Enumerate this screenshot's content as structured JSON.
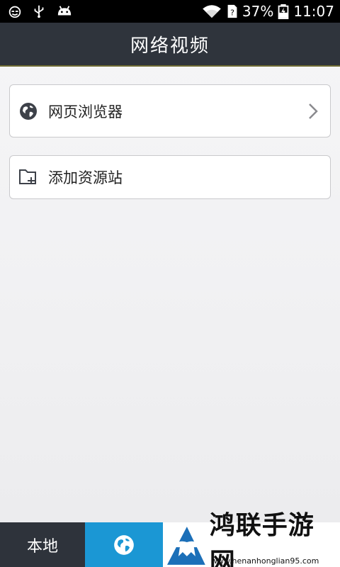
{
  "status_bar": {
    "battery_percent": "37%",
    "time": "11:07",
    "icons": [
      "cat-face-icon",
      "usb-icon",
      "android-icon",
      "wifi-icon",
      "sim-icon",
      "battery-charging-icon"
    ]
  },
  "header": {
    "title": "网络视频"
  },
  "list": {
    "items": [
      {
        "label": "网页浏览器",
        "icon": "globe-icon",
        "trailing": "chevron-right-icon"
      },
      {
        "label": "添加资源站",
        "icon": "folder-add-icon"
      }
    ]
  },
  "bottom_nav": {
    "tabs": [
      {
        "label": "本地"
      },
      {
        "icon": "globe-icon",
        "selected": true
      }
    ]
  },
  "watermark": {
    "text": "鸿联手游网",
    "url": "www.henanhonglian95.com"
  },
  "colors": {
    "title_bar": "#2f343c",
    "accent": "#1b97d4",
    "tab_dark": "#2e333b"
  }
}
